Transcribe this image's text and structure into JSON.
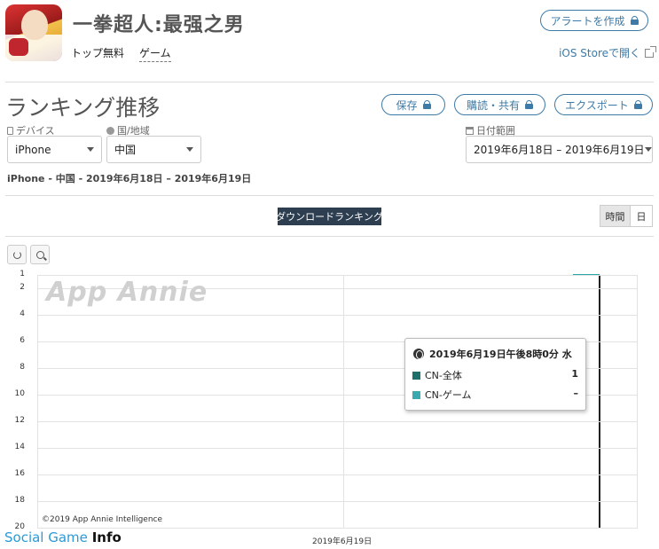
{
  "app": {
    "title": "一拳超人:最强之男",
    "categories": [
      "トップ無料",
      "ゲーム"
    ],
    "alert_button": "アラートを作成",
    "store_link": "iOS Storeで開く"
  },
  "section": {
    "title": "ランキング推移",
    "actions": [
      "保存",
      "購読・共有",
      "エクスポート"
    ]
  },
  "filters": {
    "device": {
      "label": "デバイス",
      "value": "iPhone"
    },
    "country": {
      "label": "国/地域",
      "value": "中国"
    },
    "date_range": {
      "label": "日付範囲",
      "value": "2019年6月18日 – 2019年6月19日"
    }
  },
  "summary": "iPhone - 中国 - 2019年6月18日 – 2019年6月19日",
  "ranking_type_button": "ダウンロードランキング",
  "granularity": {
    "options": [
      "時間",
      "日"
    ],
    "active": "時間"
  },
  "chart_data": {
    "type": "line",
    "y_reversed": true,
    "ylim": [
      1,
      20
    ],
    "yticks": [
      "1",
      "2",
      "4",
      "6",
      "8",
      "10",
      "12",
      "14",
      "16",
      "18",
      "20"
    ],
    "x_tick_label": "2019年6月19日",
    "series": [
      {
        "name": "CN-全体",
        "color": "#1f6f6a",
        "points": [
          {
            "x": "2019年6月19日午後8時0分",
            "y": 1
          }
        ]
      },
      {
        "name": "CN-ゲーム",
        "color": "#3aaab0",
        "points": []
      }
    ],
    "watermark": "App Annie",
    "copyright": "©2019 App Annie Intelligence"
  },
  "tooltip": {
    "header": "2019年6月19日午後8時0分 水",
    "rows": [
      {
        "name": "CN-全体",
        "value": "1",
        "color": "#1f6f6a"
      },
      {
        "name": "CN-ゲーム",
        "value": "–",
        "color": "#3aaab0"
      }
    ]
  },
  "footer": {
    "brand_a": "Social Game",
    "brand_b": "Info"
  }
}
